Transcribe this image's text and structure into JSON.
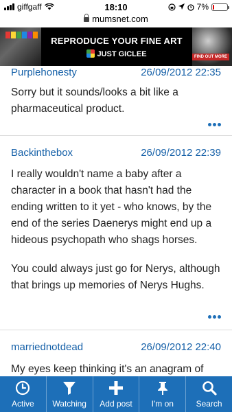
{
  "status_bar": {
    "carrier": "giffgaff",
    "time": "18:10",
    "battery": "7%",
    "battery_level": 0.07
  },
  "browser": {
    "url": "mumsnet.com"
  },
  "ad": {
    "headline": "REPRODUCE YOUR FINE ART",
    "brand": "JUST GICLEE",
    "cta": "FIND OUT MORE"
  },
  "posts": [
    {
      "poster": "Purplehonesty",
      "date": "26/09/2012 22:35",
      "body": "Sorry but it sounds/looks a bit like a pharmaceutical product."
    },
    {
      "poster": "Backinthebox",
      "date": "26/09/2012 22:39",
      "body": "I really wouldn't name a baby after a character in a book that hasn't had the ending written to it yet - who knows, by the end of the series Daenerys might end up a hideous psychopath who shags horses.",
      "body2": "You could always just go for Nerys, although that brings up memories of Nerys Hughs."
    },
    {
      "poster": "marriednotdead",
      "date": "26/09/2012 22:40",
      "body": "My eyes keep thinking it's an anagram of"
    }
  ],
  "bottom_nav": [
    {
      "label": "Active",
      "icon": "clock-icon"
    },
    {
      "label": "Watching",
      "icon": "filter-icon"
    },
    {
      "label": "Add post",
      "icon": "plus-icon"
    },
    {
      "label": "I'm on",
      "icon": "pin-icon"
    },
    {
      "label": "Search",
      "icon": "search-icon"
    }
  ],
  "colors": {
    "accent": "#1d6fb8",
    "link": "#1560a8"
  }
}
